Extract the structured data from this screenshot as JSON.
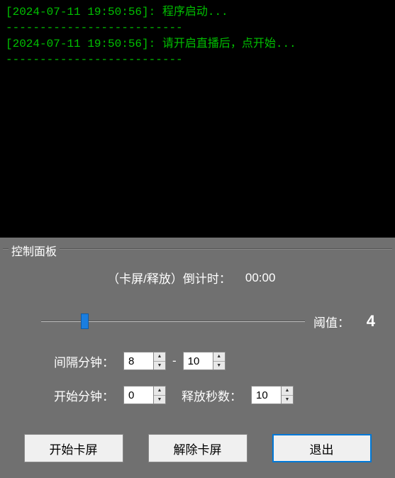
{
  "log": {
    "entries": [
      {
        "timestamp": "[2024-07-11 19:50:56]",
        "message": "程序启动..."
      },
      {
        "timestamp": "[2024-07-11 19:50:56]",
        "message": "请开启直播后，点开始..."
      }
    ],
    "divider": "--------------------------"
  },
  "panel": {
    "title": "控制面板",
    "countdown_label": "（卡屏/释放）倒计时：",
    "countdown_value": "00:00",
    "threshold_label": "阈值：",
    "threshold_value": "4",
    "interval_label": "间隔分钟：",
    "interval_min": "8",
    "interval_max": "10",
    "dash": "-",
    "start_label": "开始分钟：",
    "start_value": "0",
    "release_label": "释放秒数：",
    "release_value": "10",
    "buttons": {
      "start": "开始卡屏",
      "release": "解除卡屏",
      "exit": "退出"
    }
  }
}
